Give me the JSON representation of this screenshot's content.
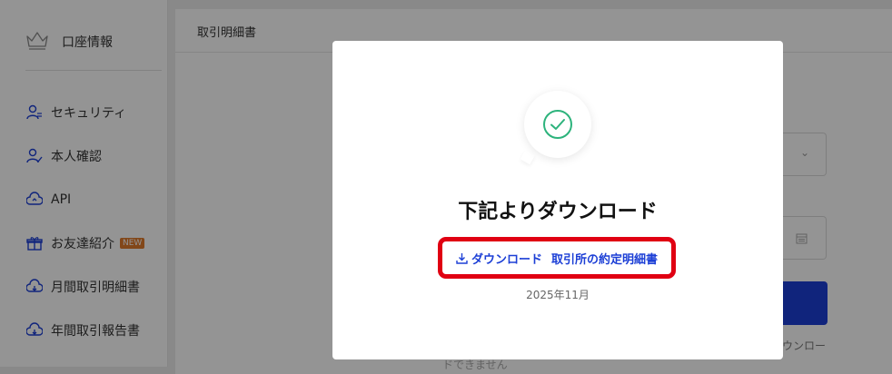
{
  "sidebar": {
    "header_label": "口座情報",
    "items": [
      {
        "label": "セキュリティ",
        "icon": "user-security-icon"
      },
      {
        "label": "本人確認",
        "icon": "user-verify-icon"
      },
      {
        "label": "API",
        "icon": "cloud-api-icon"
      },
      {
        "label": "お友達紹介",
        "icon": "gift-icon",
        "badge": "NEW"
      },
      {
        "label": "月間取引明細書",
        "icon": "cloud-download-icon"
      },
      {
        "label": "年間取引報告書",
        "icon": "cloud-download-icon"
      }
    ]
  },
  "main": {
    "title": "取引明細書",
    "bg_text_right": "ウンロー",
    "bg_text_bottom": "ドできません"
  },
  "modal": {
    "title": "下記よりダウンロード",
    "download_label": "ダウンロード",
    "document_label": "取引所の約定明細書",
    "date_label": "2025年11月"
  },
  "colors": {
    "accent": "#1c3fd6",
    "highlight_border": "#e00012",
    "success": "#2db37c",
    "badge": "#e07a2c"
  }
}
